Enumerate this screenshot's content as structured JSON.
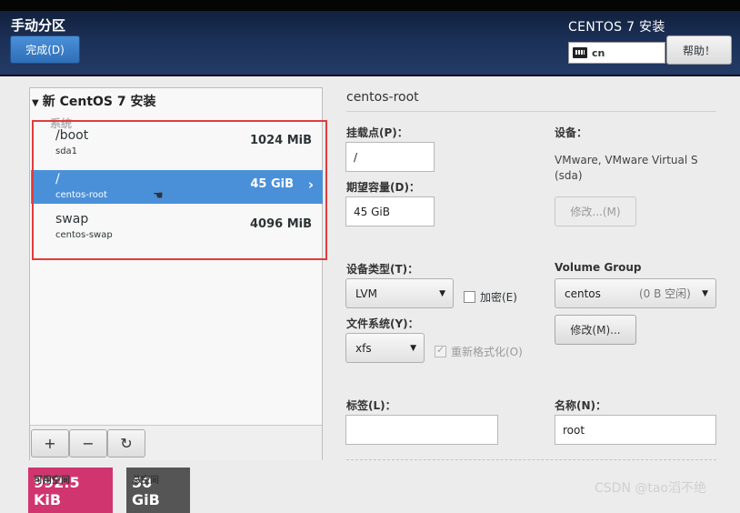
{
  "header": {
    "page_title": "手动分区",
    "done_label": "完成(D)",
    "os_title": "CENTOS 7 安装",
    "keyboard_layout": "cn",
    "help_label": "帮助！"
  },
  "left": {
    "group_title": "新 CentOS 7 安装",
    "category": "系统",
    "mounts": [
      {
        "mount": "/boot",
        "device": "sda1",
        "size": "1024 MiB",
        "selected": false
      },
      {
        "mount": "/",
        "device": "centos-root",
        "size": "45 GiB",
        "selected": true
      },
      {
        "mount": "swap",
        "device": "centos-swap",
        "size": "4096 MiB",
        "selected": false
      }
    ],
    "toolbar": {
      "add": "+",
      "remove": "−",
      "refresh": "↻"
    }
  },
  "space": {
    "available_label": "可用空间",
    "available_value": "992.5 KiB",
    "total_label": "总空间",
    "total_value": "50 GiB",
    "available_color": "#d0356f"
  },
  "detail": {
    "title": "centos-root",
    "mount_point_label": "挂载点(P)：",
    "mount_point_value": "/",
    "capacity_label": "期望容量(D)：",
    "capacity_value": "45 GiB",
    "device_label": "设备：",
    "device_text": "VMware, VMware Virtual S (sda)",
    "modify_device_label": "修改...(M)",
    "device_type_label": "设备类型(T)：",
    "device_type_value": "LVM",
    "encrypt_label": "加密(E)",
    "filesystem_label": "文件系统(Y)：",
    "filesystem_value": "xfs",
    "reformat_label": "重新格式化(O)",
    "volume_group_label": "Volume Group",
    "volume_group_value": "centos",
    "volume_group_free": "(0 B 空闲)",
    "modify_vg_label": "修改(M)...",
    "tag_label": "标签(L)：",
    "tag_value": "",
    "name_label": "名称(N)：",
    "name_value": "root"
  },
  "watermark": "CSDN @tao滔不绝",
  "selection_color": "#4a90d9"
}
